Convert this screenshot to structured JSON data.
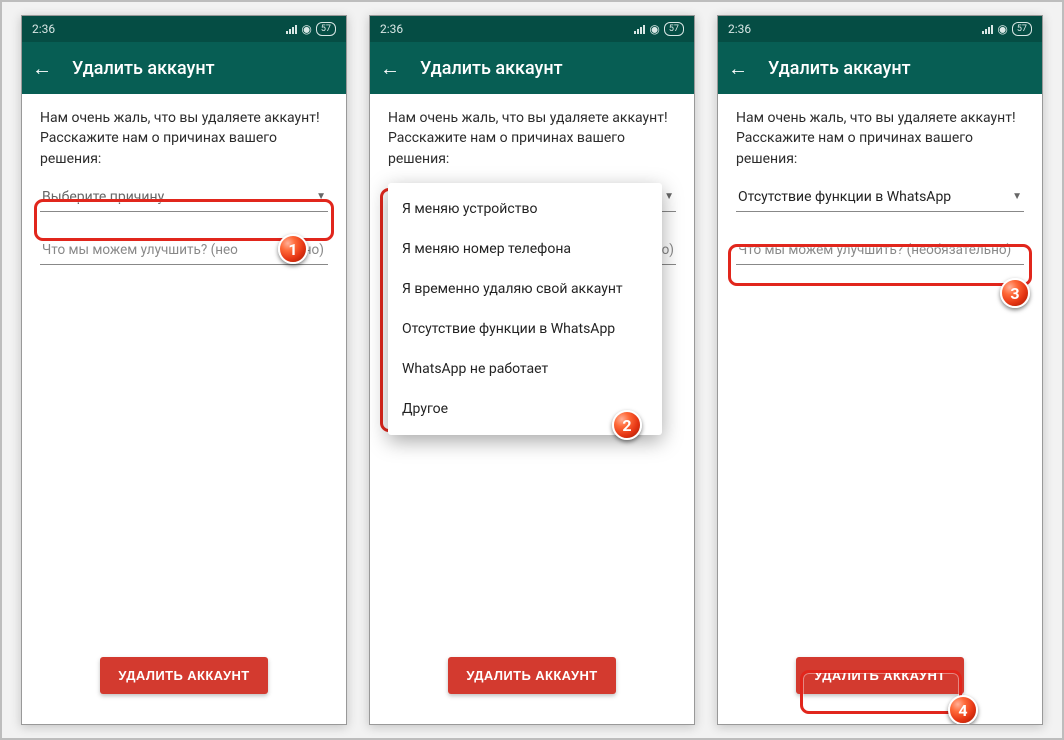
{
  "statusbar": {
    "time": "2:36",
    "battery": "57"
  },
  "appbar": {
    "title": "Удалить аккаунт"
  },
  "prompt": "Нам очень жаль, что вы удаляете аккаунт! Расскажите нам о причинах вашего решения:",
  "screen1": {
    "select_placeholder": "Выберите причину",
    "improve_placeholder_short": "Что мы можем улучшить? (нео",
    "improve_placeholder_tail": "льно)"
  },
  "screen2": {
    "options": [
      "Я меняю устройство",
      "Я меняю номер телефона",
      "Я временно удаляю свой аккаунт",
      "Отсутствие функции в WhatsApp",
      "WhatsApp не работает",
      "Другое"
    ],
    "behind_tail": "льно)"
  },
  "screen3": {
    "selected_reason": "Отсутствие функции в WhatsApp",
    "improve_placeholder": "Что мы можем улучшить? (необязательно)"
  },
  "cta_label": "УДАЛИТЬ АККАУНТ",
  "badges": {
    "b1": "1",
    "b2": "2",
    "b3": "3",
    "b4": "4"
  }
}
